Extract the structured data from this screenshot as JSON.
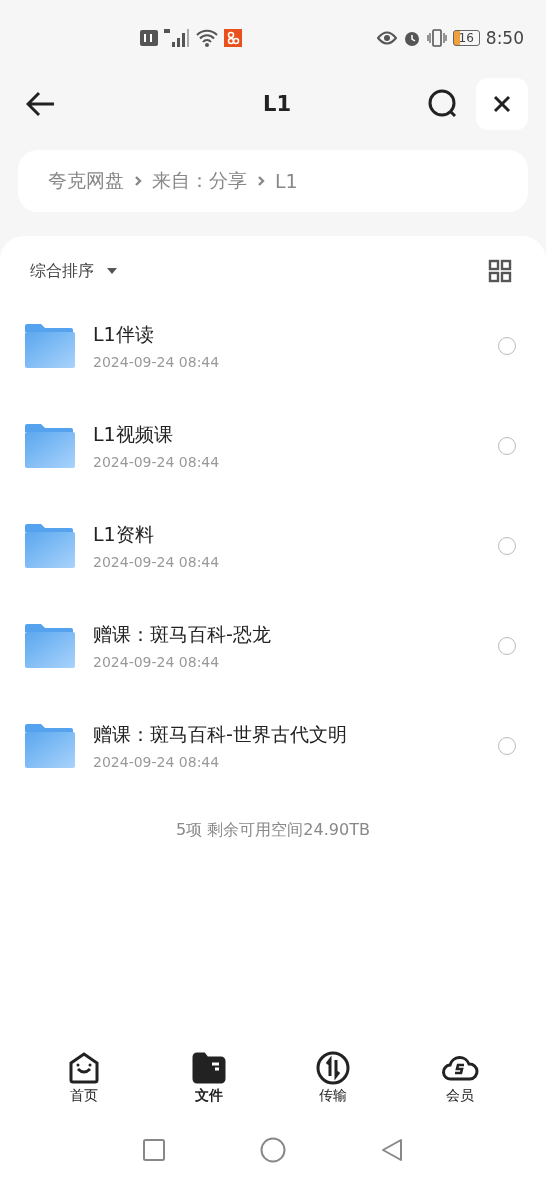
{
  "status_bar": {
    "battery": "16",
    "time": "8:50"
  },
  "header": {
    "title": "L1"
  },
  "breadcrumb": [
    "夸克网盘",
    "来自：分享",
    "L1"
  ],
  "sort": {
    "label": "综合排序"
  },
  "files": [
    {
      "name": "L1伴读",
      "date": "2024-09-24 08:44",
      "checked": false
    },
    {
      "name": "L1视频课",
      "date": "2024-09-24 08:44",
      "checked": false
    },
    {
      "name": "L1资料",
      "date": "2024-09-24 08:44",
      "checked": false
    },
    {
      "name": "赠课：斑马百科-恐龙",
      "date": "2024-09-24 08:44",
      "checked": false
    },
    {
      "name": "赠课：斑马百科-世界古代文明",
      "date": "2024-09-24 08:44",
      "checked": false
    }
  ],
  "summary": "5项 剩余可用空间24.90TB",
  "tabs": [
    {
      "label": "首页",
      "kind": "home",
      "selected": false
    },
    {
      "label": "文件",
      "kind": "files",
      "selected": true
    },
    {
      "label": "传输",
      "kind": "transfer",
      "selected": false
    },
    {
      "label": "会员",
      "kind": "member",
      "selected": false
    }
  ]
}
